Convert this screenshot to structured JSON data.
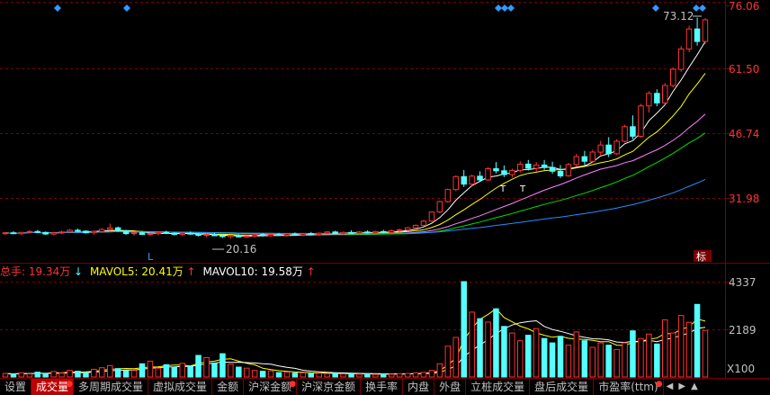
{
  "main_chart": {
    "price_axis": [
      "76.06",
      "61.50",
      "46.74",
      "31.98"
    ],
    "high_label": "73.12",
    "low_label": "20.16",
    "badge": "标",
    "tag_T1": "T",
    "tag_T2": "T",
    "tag_L": "L"
  },
  "volume_panel": {
    "total": "总手: 19.34万",
    "total_arrow": "↓",
    "mavol5": "MAVOL5: 20.41万",
    "mavol5_arrow": "↑",
    "mavol10": "MAVOL10: 19.58万",
    "mavol10_arrow": "↑",
    "axis": [
      "4337",
      "2189",
      "X100"
    ]
  },
  "colors": {
    "up": "#ff3232",
    "down": "#54ffff",
    "ma5": "#ffffff",
    "ma10": "#ffff00",
    "ma20": "#ff80ff",
    "ma30": "#00e000",
    "ma60": "#1e90ff",
    "grid": "#7a0000"
  },
  "chart_data": {
    "type": "candlestick",
    "y_range_price": [
      15.5,
      76.06
    ],
    "y_range_volume": [
      0,
      4800
    ],
    "volume_unit": "X100",
    "candles": [
      [
        21.2,
        21.5,
        20.9,
        21.4
      ],
      [
        21.4,
        21.8,
        21.1,
        21.2
      ],
      [
        21.2,
        21.6,
        20.8,
        21.5
      ],
      [
        21.5,
        22.0,
        21.2,
        21.7
      ],
      [
        21.7,
        22.1,
        21.3,
        21.5
      ],
      [
        21.5,
        21.7,
        20.9,
        21.1
      ],
      [
        21.1,
        21.6,
        20.8,
        21.4
      ],
      [
        21.4,
        21.9,
        21.1,
        21.6
      ],
      [
        21.6,
        22.3,
        21.3,
        22.0
      ],
      [
        22.0,
        22.4,
        21.5,
        21.8
      ],
      [
        21.8,
        22.0,
        21.2,
        21.4
      ],
      [
        21.4,
        21.9,
        21.0,
        21.7
      ],
      [
        21.7,
        22.5,
        21.4,
        22.2
      ],
      [
        22.2,
        23.6,
        21.9,
        22.6
      ],
      [
        22.6,
        22.9,
        21.6,
        21.9
      ],
      [
        21.9,
        22.1,
        20.9,
        21.2
      ],
      [
        21.2,
        21.6,
        20.7,
        21.4
      ],
      [
        21.4,
        21.8,
        20.9,
        21.0
      ],
      [
        21.0,
        21.4,
        20.6,
        21.2
      ],
      [
        21.2,
        21.7,
        20.8,
        21.5
      ],
      [
        21.5,
        21.9,
        21.1,
        21.3
      ],
      [
        21.3,
        21.6,
        20.8,
        21.0
      ],
      [
        21.0,
        21.5,
        20.6,
        21.3
      ],
      [
        21.3,
        21.7,
        20.9,
        21.1
      ],
      [
        21.1,
        21.4,
        20.5,
        20.8
      ],
      [
        20.8,
        21.2,
        20.3,
        21.0
      ],
      [
        21.0,
        21.4,
        20.6,
        20.7
      ],
      [
        20.7,
        21.0,
        20.2,
        20.5
      ],
      [
        20.5,
        20.9,
        20.0,
        20.8
      ],
      [
        20.8,
        21.1,
        20.3,
        20.4
      ],
      [
        20.4,
        20.8,
        20.16,
        20.6
      ],
      [
        20.6,
        21.0,
        20.2,
        20.9
      ],
      [
        20.9,
        21.3,
        20.5,
        20.7
      ],
      [
        20.7,
        21.2,
        20.4,
        21.0
      ],
      [
        21.0,
        21.4,
        20.6,
        20.8
      ],
      [
        20.8,
        21.3,
        20.5,
        21.1
      ],
      [
        21.1,
        21.5,
        20.7,
        20.9
      ],
      [
        20.9,
        21.3,
        20.6,
        21.2
      ],
      [
        21.2,
        21.6,
        20.8,
        21.0
      ],
      [
        21.0,
        21.5,
        20.7,
        21.3
      ],
      [
        21.3,
        21.8,
        21.0,
        21.6
      ],
      [
        21.6,
        21.9,
        21.1,
        21.2
      ],
      [
        21.2,
        21.7,
        20.9,
        21.5
      ],
      [
        21.5,
        22.0,
        21.2,
        21.3
      ],
      [
        21.3,
        21.8,
        21.0,
        21.6
      ],
      [
        21.6,
        22.0,
        21.2,
        21.4
      ],
      [
        21.4,
        21.9,
        21.1,
        21.7
      ],
      [
        21.7,
        22.1,
        21.3,
        21.5
      ],
      [
        21.5,
        22.2,
        21.2,
        21.9
      ],
      [
        21.9,
        22.4,
        21.5,
        22.1
      ],
      [
        22.1,
        22.8,
        21.8,
        22.6
      ],
      [
        22.6,
        23.4,
        22.3,
        23.2
      ],
      [
        23.2,
        24.5,
        22.9,
        24.2
      ],
      [
        24.2,
        26.6,
        24.0,
        26.4
      ],
      [
        26.4,
        29.1,
        26.1,
        28.9
      ],
      [
        28.9,
        32.0,
        28.6,
        31.8
      ],
      [
        31.8,
        35.2,
        31.4,
        34.9
      ],
      [
        34.9,
        36.5,
        32.4,
        33.1
      ],
      [
        33.1,
        35.4,
        32.7,
        35.0
      ],
      [
        35.0,
        36.2,
        33.6,
        34.1
      ],
      [
        34.1,
        37.2,
        33.8,
        36.8
      ],
      [
        36.8,
        38.4,
        35.7,
        36.3
      ],
      [
        36.3,
        37.6,
        34.8,
        35.4
      ],
      [
        35.4,
        36.8,
        34.7,
        36.4
      ],
      [
        36.4,
        38.6,
        35.9,
        37.9
      ],
      [
        37.9,
        38.9,
        36.4,
        36.9
      ],
      [
        36.9,
        38.4,
        36.1,
        37.7
      ],
      [
        37.7,
        38.9,
        36.5,
        37.1
      ],
      [
        37.1,
        38.5,
        35.6,
        36.2
      ],
      [
        36.2,
        37.7,
        34.6,
        35.1
      ],
      [
        35.1,
        38.2,
        34.9,
        37.8
      ],
      [
        37.8,
        40.4,
        37.2,
        39.7
      ],
      [
        39.7,
        41.1,
        37.6,
        38.6
      ],
      [
        38.6,
        41.4,
        38.2,
        40.8
      ],
      [
        40.8,
        43.5,
        40.1,
        42.5
      ],
      [
        42.5,
        44.4,
        39.6,
        40.4
      ],
      [
        40.4,
        43.9,
        40.1,
        43.4
      ],
      [
        43.4,
        47.4,
        43.1,
        46.9
      ],
      [
        46.9,
        49.6,
        43.9,
        44.6
      ],
      [
        44.6,
        52.4,
        44.3,
        51.9
      ],
      [
        51.9,
        55.4,
        50.3,
        54.9
      ],
      [
        54.9,
        55.9,
        51.8,
        52.6
      ],
      [
        52.6,
        57.4,
        52.2,
        56.8
      ],
      [
        56.8,
        61.2,
        56.3,
        60.7
      ],
      [
        60.7,
        66.3,
        60.1,
        65.6
      ],
      [
        65.6,
        71.2,
        64.8,
        70.4
      ],
      [
        70.4,
        73.12,
        66.4,
        67.4
      ],
      [
        67.4,
        73.0,
        66.8,
        72.6
      ]
    ],
    "volume": [
      160,
      130,
      190,
      140,
      220,
      150,
      250,
      180,
      300,
      260,
      200,
      350,
      420,
      520,
      380,
      280,
      300,
      600,
      720,
      400,
      560,
      450,
      620,
      480,
      980,
      880,
      640,
      1060,
      580,
      450,
      400,
      300,
      260,
      280,
      200,
      220,
      180,
      190,
      160,
      170,
      150,
      165,
      140,
      150,
      130,
      145,
      120,
      140,
      130,
      150,
      160,
      190,
      210,
      300,
      600,
      1400,
      1800,
      4337,
      2950,
      2650,
      2500,
      3100,
      2300,
      2000,
      1650,
      1900,
      2200,
      1750,
      1550,
      1850,
      1450,
      2050,
      1650,
      1350,
      1550,
      1450,
      1250,
      1550,
      2100,
      1750,
      1950,
      1500,
      2600,
      2000,
      2800,
      2489,
      3300,
      2120
    ]
  }
}
